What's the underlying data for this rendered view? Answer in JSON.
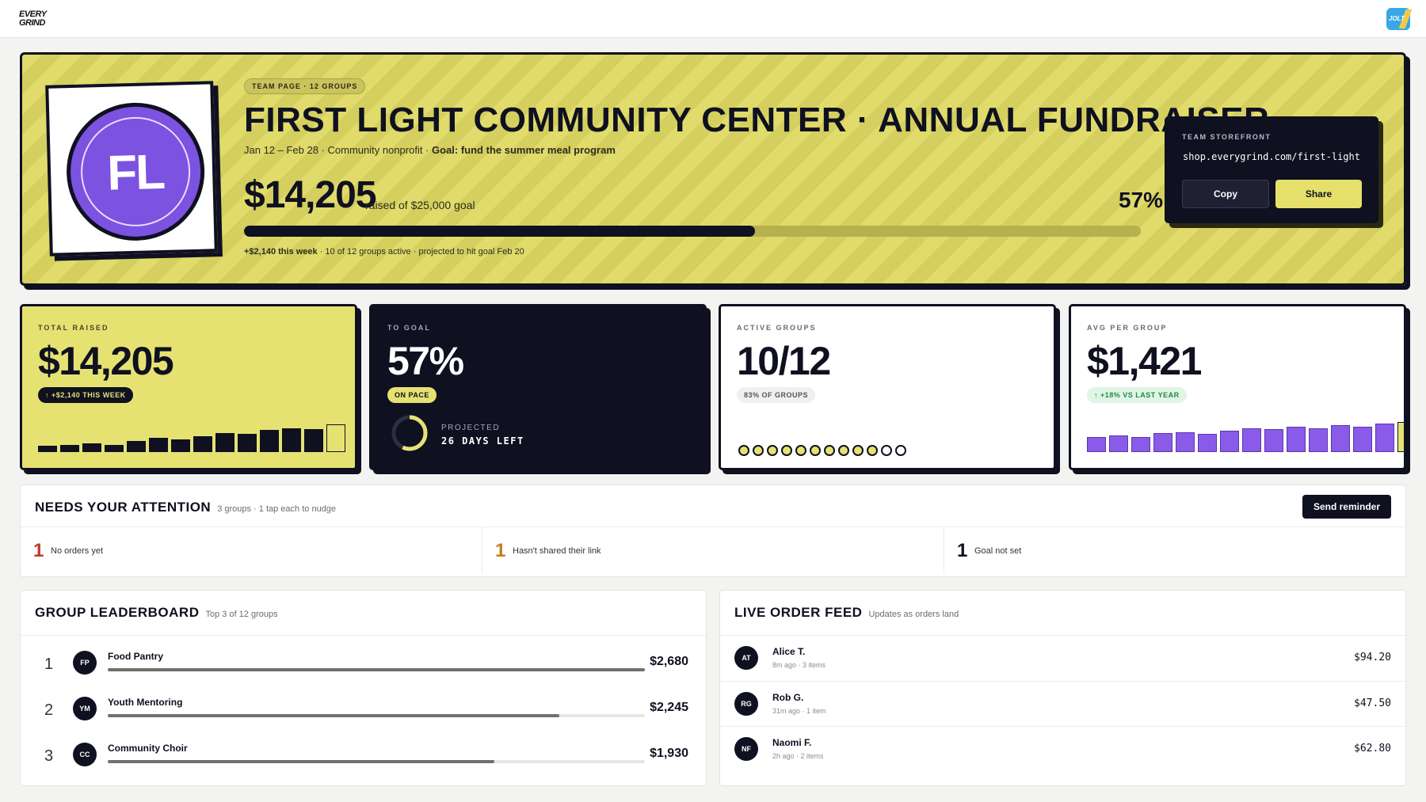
{
  "header": {
    "brand_line1": "EVERY",
    "brand_line2": "GRIND",
    "app_badge": "JOLT"
  },
  "hero": {
    "avatar_initials": "FL",
    "tag": "TEAM PAGE · 12 GROUPS",
    "title": "FIRST LIGHT COMMUNITY CENTER · ANNUAL FUNDRAISER",
    "subtitle_plain": "Jan 12 – Feb 28 · Community nonprofit · ",
    "subtitle_bold": "Goal: fund the summer meal program",
    "amount": "$14,205",
    "raised_text": "raised of $25,000 goal",
    "percent": "57%",
    "progress": 0.57,
    "note_bold": "+$2,140 this week",
    "note_plain": " · 10 of 12 groups active · projected to hit goal Feb 20"
  },
  "storefront": {
    "label": "TEAM STOREFRONT",
    "url": "shop.everygrind.com/first-light",
    "copy_label": "Copy",
    "share_label": "Share"
  },
  "stats": {
    "total": {
      "label": "TOTAL RAISED",
      "value": "$14,205",
      "badge": "↑ +$2,140 THIS WEEK",
      "bars": [
        0.18,
        0.22,
        0.26,
        0.22,
        0.34,
        0.42,
        0.38,
        0.48,
        0.58,
        0.54,
        0.66,
        0.72,
        0.68,
        0.84
      ]
    },
    "goal": {
      "label": "TO GOAL",
      "value": "57%",
      "badge": "ON PACE",
      "projected_label": "PROJECTED",
      "projected_value": "26 DAYS LEFT",
      "progress": 0.57
    },
    "groups": {
      "label": "ACTIVE GROUPS",
      "value": "10/12",
      "badge": "83% OF GROUPS",
      "active": 10,
      "total": 12
    },
    "avg": {
      "label": "AVG PER GROUP",
      "value": "$1,421",
      "badge": "↑ +18% VS LAST YEAR",
      "bars": [
        0.45,
        0.5,
        0.46,
        0.56,
        0.6,
        0.55,
        0.64,
        0.72,
        0.68,
        0.76,
        0.72,
        0.8,
        0.76,
        0.86,
        0.9
      ]
    }
  },
  "attention": {
    "title": "NEEDS YOUR ATTENTION",
    "subtitle": "3 groups · 1 tap each to nudge",
    "button": "Send reminder",
    "items": [
      {
        "count": "1",
        "text": "No orders yet",
        "color": "#c0392b"
      },
      {
        "count": "1",
        "text": "Hasn't shared their link",
        "color": "#c77d1a"
      },
      {
        "count": "1",
        "text": "Goal not set",
        "color": "#0f1020"
      }
    ]
  },
  "leaderboard": {
    "title": "GROUP LEADERBOARD",
    "subtitle": "Top 3 of 12 groups",
    "rows": [
      {
        "rank": "1",
        "initials": "FP",
        "name": "Food Pantry",
        "amount": "$2,680",
        "progress": 1.0
      },
      {
        "rank": "2",
        "initials": "YM",
        "name": "Youth Mentoring",
        "amount": "$2,245",
        "progress": 0.84
      },
      {
        "rank": "3",
        "initials": "CC",
        "name": "Community Choir",
        "amount": "$1,930",
        "progress": 0.72
      }
    ]
  },
  "feed": {
    "title": "LIVE ORDER FEED",
    "subtitle": "Updates as orders land",
    "rows": [
      {
        "initials": "AT",
        "name": "Alice T.",
        "meta": "8m ago · 3 items",
        "amount": "$94.20"
      },
      {
        "initials": "RG",
        "name": "Rob G.",
        "meta": "31m ago · 1 item",
        "amount": "$47.50"
      },
      {
        "initials": "NF",
        "name": "Naomi F.",
        "meta": "2h ago · 2 items",
        "amount": "$62.80"
      }
    ]
  },
  "colors": {
    "accent_yellow": "#e6e272",
    "ink": "#0f1020",
    "purple": "#7c52e0"
  }
}
